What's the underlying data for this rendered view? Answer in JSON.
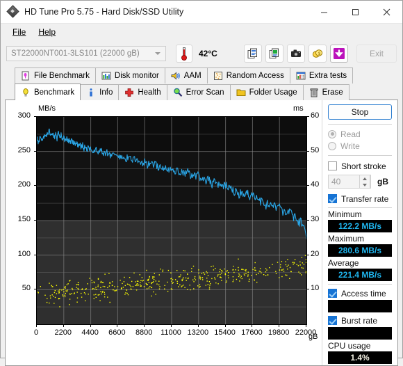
{
  "window": {
    "title": "HD Tune Pro 5.75 - Hard Disk/SSD Utility",
    "icon": "hdtune-diamond-icon",
    "minimize": "—",
    "maximize": "☐",
    "close": "✕"
  },
  "menu": {
    "items": [
      "File",
      "Help"
    ]
  },
  "toolbar": {
    "drive": "ST22000NT001-3LS101 (22000 gB)",
    "temperature": "42°C",
    "buttons": [
      {
        "name": "copy-text-icon"
      },
      {
        "name": "copy-image-icon"
      },
      {
        "name": "screenshot-camera-icon"
      },
      {
        "name": "coins-icon"
      },
      {
        "name": "download-arrow-icon"
      }
    ],
    "exit_label": "Exit"
  },
  "tabs": {
    "row1": [
      {
        "label": "File Benchmark",
        "icon": "file-benchmark-icon",
        "selected": false
      },
      {
        "label": "Disk monitor",
        "icon": "disk-monitor-icon",
        "selected": false
      },
      {
        "label": "AAM",
        "icon": "aam-speaker-icon",
        "selected": false
      },
      {
        "label": "Random Access",
        "icon": "random-access-icon",
        "selected": false
      },
      {
        "label": "Extra tests",
        "icon": "extra-tests-icon",
        "selected": false
      }
    ],
    "row2": [
      {
        "label": "Benchmark",
        "icon": "benchmark-bulb-icon",
        "selected": true
      },
      {
        "label": "Info",
        "icon": "info-icon",
        "selected": false
      },
      {
        "label": "Health",
        "icon": "health-cross-icon",
        "selected": false
      },
      {
        "label": "Error Scan",
        "icon": "error-scan-magnifier-icon",
        "selected": false
      },
      {
        "label": "Folder Usage",
        "icon": "folder-usage-icon",
        "selected": false
      },
      {
        "label": "Erase",
        "icon": "erase-trash-icon",
        "selected": false
      }
    ]
  },
  "panel": {
    "stop_label": "Stop",
    "mode": {
      "read_label": "Read",
      "write_label": "Write",
      "selected": "Read"
    },
    "short_stroke": {
      "label": "Short stroke",
      "checked": false,
      "value": "40",
      "unit": "gB"
    },
    "transfer_rate": {
      "label": "Transfer rate",
      "checked": true
    },
    "minimum": {
      "label": "Minimum",
      "value": "122.2 MB/s"
    },
    "maximum": {
      "label": "Maximum",
      "value": "280.6 MB/s"
    },
    "average": {
      "label": "Average",
      "value": "221.4 MB/s"
    },
    "access_time": {
      "label": "Access time",
      "checked": true,
      "value": ""
    },
    "burst_rate": {
      "label": "Burst rate",
      "checked": true,
      "value": ""
    },
    "cpu_usage": {
      "label": "CPU usage",
      "value": "1.4%"
    },
    "colors": {
      "accent": "#1fb6f0",
      "transfer_line": "#2aa7e8",
      "access_dots": "#ffff00",
      "cpu_text": "#f2efe2"
    }
  },
  "chart_data": {
    "type": "line",
    "title": "",
    "xlabel": "gB",
    "ylabel": "MB/s",
    "y2label": "ms",
    "xlim": [
      0,
      22000
    ],
    "ylim": [
      0,
      300
    ],
    "y2lim": [
      0,
      60
    ],
    "grid": true,
    "legend": "none",
    "xticks": [
      0,
      2200,
      4400,
      6600,
      8800,
      11000,
      13200,
      15400,
      17600,
      19800,
      22000
    ],
    "yticks": [
      0,
      50,
      100,
      150,
      200,
      250,
      300
    ],
    "y2ticks": [
      0,
      10,
      20,
      30,
      40,
      50,
      60
    ],
    "series": [
      {
        "name": "Transfer rate",
        "axis": "left",
        "units": "MB/s",
        "color": "#2aa7e8",
        "x": [
          0,
          110,
          220,
          330,
          440,
          550,
          660,
          770,
          880,
          990,
          1100,
          1210,
          1320,
          1430,
          1540,
          1650,
          1760,
          1870,
          1980,
          2090,
          2200,
          2310,
          2420,
          2530,
          2640,
          2750,
          2860,
          2970,
          3080,
          3190,
          3300,
          3410,
          3520,
          3630,
          3740,
          3850,
          3960,
          4070,
          4180,
          4290,
          4400,
          4620,
          4840,
          5060,
          5280,
          5500,
          5720,
          5940,
          6160,
          6380,
          6600,
          6820,
          7040,
          7260,
          7480,
          7700,
          7920,
          8140,
          8360,
          8580,
          8800,
          9020,
          9240,
          9460,
          9680,
          9900,
          10120,
          10340,
          10560,
          10780,
          11000,
          11220,
          11440,
          11660,
          11880,
          12100,
          12320,
          12540,
          12760,
          12980,
          13200,
          13420,
          13640,
          13860,
          14080,
          14300,
          14520,
          14740,
          14960,
          15180,
          15400,
          15620,
          15840,
          16060,
          16280,
          16500,
          16720,
          16940,
          17160,
          17380,
          17600,
          17820,
          18040,
          18260,
          18480,
          18700,
          18920,
          19140,
          19360,
          19580,
          19800,
          20020,
          20240,
          20460,
          20680,
          20900,
          21120,
          21340,
          21560,
          21780,
          22000
        ],
        "y": [
          272,
          262,
          268,
          271,
          266,
          270,
          274,
          272,
          276,
          280.6,
          275,
          272,
          277,
          270,
          274,
          268,
          276,
          270,
          274,
          268,
          272,
          266,
          270,
          264,
          268,
          262,
          266,
          261,
          264,
          259,
          262,
          257,
          260,
          256,
          259,
          254,
          257,
          252,
          256,
          251,
          254,
          250,
          253,
          248,
          251,
          246,
          249,
          244,
          247,
          242,
          246,
          241,
          244,
          239,
          242,
          237,
          240,
          235,
          238,
          233,
          236,
          231,
          234,
          229,
          232,
          227,
          230,
          225,
          228,
          223,
          226,
          221,
          224,
          219,
          222,
          217,
          220,
          214,
          218,
          212,
          216,
          209,
          214,
          206,
          211,
          203,
          208,
          200,
          205,
          197,
          202,
          194,
          199,
          191,
          196,
          188,
          193,
          185,
          190,
          182,
          187,
          179,
          184,
          176,
          180,
          173,
          177,
          170,
          174,
          167,
          171,
          163,
          167,
          158,
          163,
          152,
          158,
          145,
          151,
          138,
          122.2
        ]
      },
      {
        "name": "Access time",
        "axis": "right",
        "units": "ms",
        "color": "#ffff00",
        "style": "scatter",
        "x_range": [
          0,
          22000
        ],
        "y_range": [
          4,
          22
        ],
        "trend_start_ms": 8.5,
        "trend_end_ms": 17.0,
        "spread_ms": 5.5,
        "n_points": 430
      }
    ]
  }
}
